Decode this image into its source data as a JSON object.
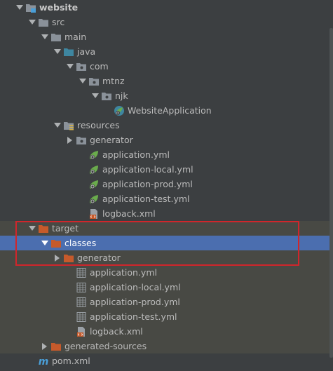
{
  "colors": {
    "background": "#3c3f41",
    "selection": "#4b6eaf",
    "excluded_band": "#484944",
    "folder_plain": "#8a9199",
    "folder_source": "#3e86a0",
    "folder_target": "#c65a2b",
    "spring_green": "#6aab4c",
    "annotation_red": "#d0262b"
  },
  "tree": [
    {
      "label": "website",
      "depth": 0,
      "arrow": "down",
      "icon": "module-folder-icon",
      "bold": true
    },
    {
      "label": "src",
      "depth": 1,
      "arrow": "down",
      "icon": "folder-icon"
    },
    {
      "label": "main",
      "depth": 2,
      "arrow": "down",
      "icon": "folder-icon"
    },
    {
      "label": "java",
      "depth": 3,
      "arrow": "down",
      "icon": "source-folder-icon"
    },
    {
      "label": "com",
      "depth": 4,
      "arrow": "down",
      "icon": "package-icon"
    },
    {
      "label": "mtnz",
      "depth": 5,
      "arrow": "down",
      "icon": "package-icon"
    },
    {
      "label": "njk",
      "depth": 6,
      "arrow": "down",
      "icon": "package-icon"
    },
    {
      "label": "WebsiteApplication",
      "depth": 7,
      "arrow": "none",
      "icon": "spring-boot-class-icon"
    },
    {
      "label": "resources",
      "depth": 3,
      "arrow": "down",
      "icon": "resources-folder-icon"
    },
    {
      "label": "generator",
      "depth": 4,
      "arrow": "right",
      "icon": "package-icon"
    },
    {
      "label": "application.yml",
      "depth": 5,
      "arrow": "none",
      "icon": "spring-config-icon"
    },
    {
      "label": "application-local.yml",
      "depth": 5,
      "arrow": "none",
      "icon": "spring-config-icon"
    },
    {
      "label": "application-prod.yml",
      "depth": 5,
      "arrow": "none",
      "icon": "spring-config-icon"
    },
    {
      "label": "application-test.yml",
      "depth": 5,
      "arrow": "none",
      "icon": "spring-config-icon"
    },
    {
      "label": "logback.xml",
      "depth": 5,
      "arrow": "none",
      "icon": "xml-file-icon"
    },
    {
      "label": "target",
      "depth": 1,
      "arrow": "down",
      "icon": "excluded-folder-icon",
      "excluded": true
    },
    {
      "label": "classes",
      "depth": 2,
      "arrow": "down",
      "icon": "excluded-folder-icon",
      "selected": true
    },
    {
      "label": "generator",
      "depth": 3,
      "arrow": "right",
      "icon": "excluded-folder-icon",
      "excluded": true
    },
    {
      "label": "application.yml",
      "depth": 4,
      "arrow": "none",
      "icon": "text-file-icon",
      "excluded": true
    },
    {
      "label": "application-local.yml",
      "depth": 4,
      "arrow": "none",
      "icon": "text-file-icon",
      "excluded": true
    },
    {
      "label": "application-prod.yml",
      "depth": 4,
      "arrow": "none",
      "icon": "text-file-icon",
      "excluded": true
    },
    {
      "label": "application-test.yml",
      "depth": 4,
      "arrow": "none",
      "icon": "text-file-icon",
      "excluded": true
    },
    {
      "label": "logback.xml",
      "depth": 4,
      "arrow": "none",
      "icon": "xml-file-icon",
      "excluded": true
    },
    {
      "label": "generated-sources",
      "depth": 2,
      "arrow": "right",
      "icon": "excluded-folder-icon",
      "excluded": true
    },
    {
      "label": "pom.xml",
      "depth": 1,
      "arrow": "none",
      "icon": "maven-pom-icon"
    }
  ]
}
